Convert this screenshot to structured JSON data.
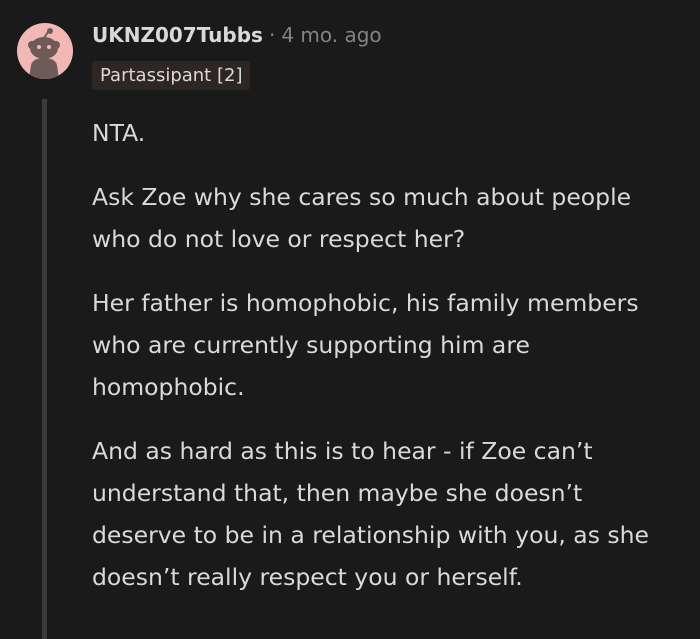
{
  "comment": {
    "username": "UKNZ007Tubbs",
    "separator": "·",
    "timestamp": "4 mo. ago",
    "flair": "Partassipant [2]",
    "paragraphs": [
      "NTA.",
      "Ask Zoe why she cares so much about people who do not love or respect her?",
      "Her father is homophobic, his family members who are currently supporting him are homophobic.",
      "And as hard as this is to hear - if Zoe can’t understand that, then maybe she doesn’t deserve to be in a relationship with you, as she doesn’t really respect you or herself."
    ]
  },
  "colors": {
    "background": "#1a1a1b",
    "avatar_background": "#f2b8b6",
    "avatar_figure": "#6e5a56",
    "text": "#d7dadc",
    "meta_text": "#818384",
    "flair_background": "#2d2623",
    "thread_line": "#3c3c3c"
  },
  "icons": {
    "avatar": "snoo-avatar-icon"
  }
}
